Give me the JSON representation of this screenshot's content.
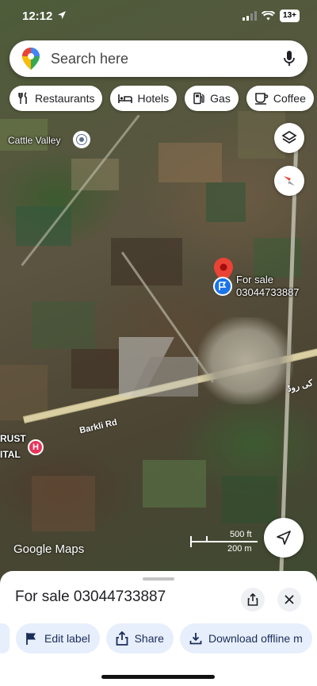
{
  "status_bar": {
    "time": "12:12",
    "battery": "13+"
  },
  "search": {
    "placeholder": "Search here"
  },
  "chips": [
    {
      "label": "Restaurants",
      "icon": "fork-knife-icon"
    },
    {
      "label": "Hotels",
      "icon": "bed-icon"
    },
    {
      "label": "Gas",
      "icon": "gas-pump-icon"
    },
    {
      "label": "Coffee",
      "icon": "coffee-cup-icon"
    }
  ],
  "map": {
    "place_label": "Cattle Valley",
    "pin_title": "For sale",
    "pin_phone": "03044733887",
    "road_name": "Barkli Rd",
    "road_name_other": "کی روڈ",
    "hospital_label_1": "RUST",
    "hospital_label_2": "ITAL",
    "scale_ft": "500 ft",
    "scale_m": "200 m",
    "logo_text": "Google Maps"
  },
  "sheet": {
    "title": "For sale 03044733887",
    "actions": [
      {
        "label": "Edit label",
        "icon": "flag-icon"
      },
      {
        "label": "Share",
        "icon": "share-icon"
      },
      {
        "label": "Download offline m",
        "icon": "download-icon"
      }
    ]
  },
  "colors": {
    "accent": "#1a73e8",
    "pin_red": "#ea4335",
    "chip_bg": "#ffffff",
    "action_bg": "#e7eefc"
  }
}
